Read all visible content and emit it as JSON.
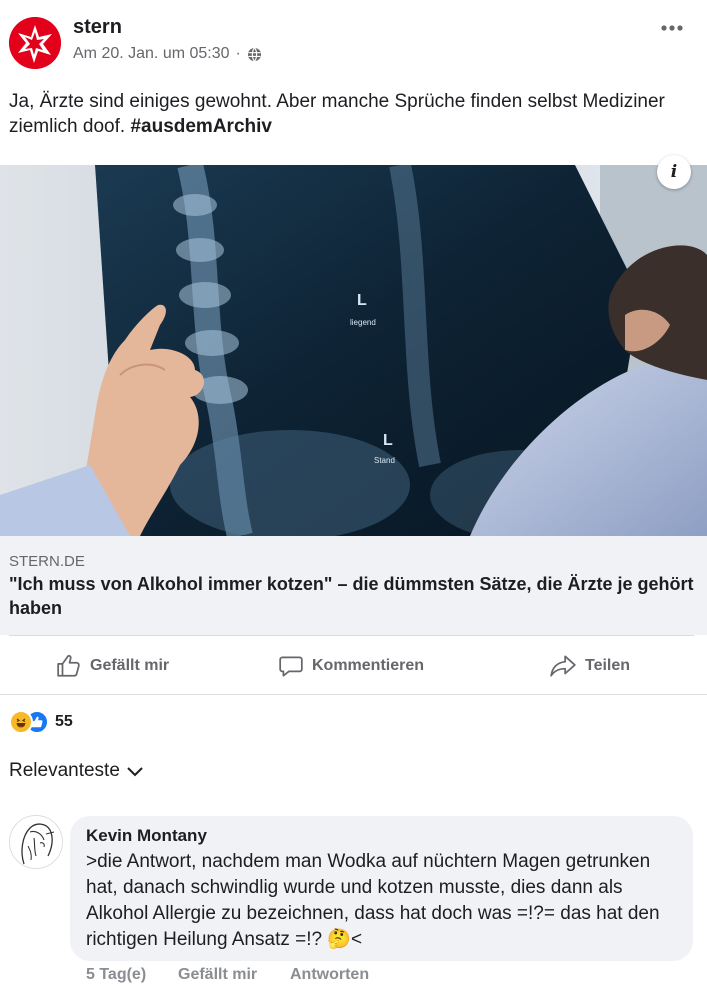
{
  "post": {
    "page_name": "stern",
    "timestamp": "Am 20. Jan. um 05:30",
    "separator": "·",
    "audience_icon": "globe-icon",
    "more_icon": "more-dots-icon",
    "text_plain": "Ja, Ärzte sind einiges gewohnt. Aber manche Sprüche finden selbst Mediziner ziemlich doof.",
    "hashtag": "#ausdemArchiv"
  },
  "link_preview": {
    "info_label": "i",
    "domain": "STERN.DE",
    "title": "\"Ich muss von Alkohol immer kotzen\" – die dümmsten Sätze, die Ärzte je gehört haben",
    "xray_labels": [
      "L",
      "liegend",
      "L",
      "Stand"
    ]
  },
  "actions": {
    "like": "Gefällt mir",
    "comment": "Kommentieren",
    "share": "Teilen"
  },
  "reactions": {
    "count": "55",
    "types": [
      "haha",
      "like"
    ]
  },
  "sort": {
    "label": "Relevanteste"
  },
  "comment": {
    "author": "Kevin Montany",
    "text": ">die Antwort, nachdem man Wodka auf nüchtern Magen getrunken hat, danach schwindlig wurde und kotzen musste, dies dann als Alkohol Allergie zu bezeichnen, dass hat doch was =!?= das hat den richtigen Heilung Ansatz =!? 🤔<",
    "age": "5 Tag(e)",
    "like": "Gefällt mir",
    "reply": "Antworten"
  },
  "colors": {
    "brand": "#e2001a",
    "like_blue": "#1877f2",
    "haha_yellow": "#f7b928",
    "text": "#1c1e21",
    "secondary": "#65676b"
  }
}
